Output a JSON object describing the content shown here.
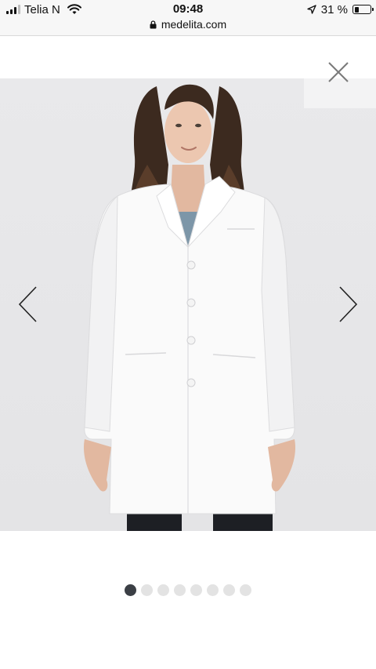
{
  "status_bar": {
    "carrier": "Telia N",
    "time": "09:48",
    "battery_percent": "31 %",
    "battery_level": 0.31,
    "signal_bars_on": 3,
    "signal_bars_total": 4,
    "url": "medelita.com"
  },
  "gallery": {
    "image_count": 8,
    "active_index": 0,
    "icons": {
      "close": "close-icon",
      "prev": "chevron-left-icon",
      "next": "chevron-right-icon"
    }
  },
  "colors": {
    "photo_background": "#e7e7e9",
    "coat": "#fafafa",
    "dot_active": "#3b3f45",
    "dot_inactive": "#e3e3e3"
  }
}
